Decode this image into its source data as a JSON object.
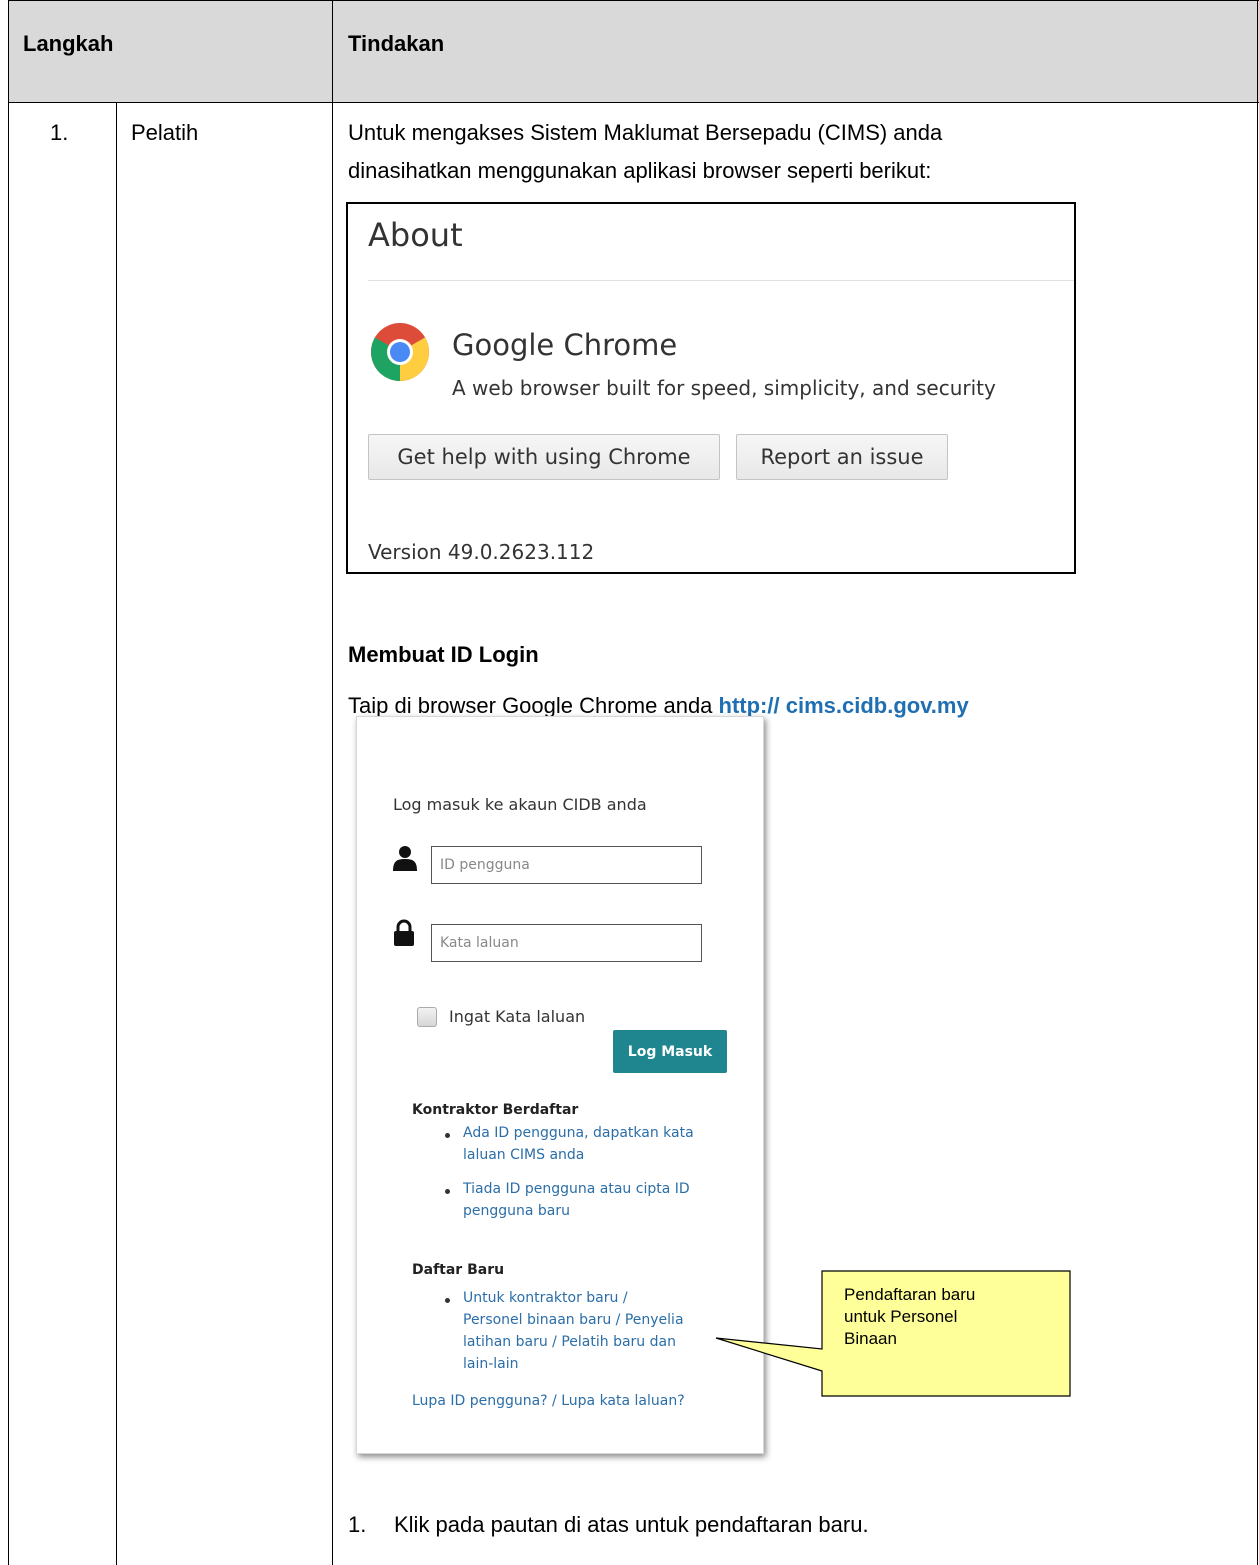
{
  "table": {
    "header": {
      "col1": "Langkah",
      "col2": "Tindakan"
    },
    "row": {
      "number": "1.",
      "role": "Pelatih"
    }
  },
  "content": {
    "intro_line1": "Untuk mengakses Sistem Maklumat Bersepadu (CIMS) anda",
    "intro_line2": "dinasihatkan menggunakan aplikasi browser seperti berikut:",
    "section_heading": "Membuat ID Login",
    "type_prefix": "Taip di browser Google Chrome anda ",
    "url": "http:// cims.cidb.gov.my",
    "step_number": "1.",
    "step_text": "Klik pada pautan di atas untuk pendaftaran baru."
  },
  "about_box": {
    "title": "About",
    "product_name": "Google Chrome",
    "description": "A web browser built for speed, simplicity, and security",
    "help_button": "Get help with using Chrome",
    "report_button": "Report an issue",
    "version": "Version 49.0.2623.112"
  },
  "login_box": {
    "title": "Log masuk ke akaun CIDB anda",
    "user_placeholder": "ID pengguna",
    "password_placeholder": "Kata laluan",
    "remember_label": "Ingat Kata laluan",
    "login_button": "Log Masuk",
    "registered_heading": "Kontraktor Berdaftar",
    "registered_link1_line1": "Ada ID pengguna, dapatkan kata",
    "registered_link1_line2": "laluan CIMS anda",
    "registered_link2_line1": "Tiada ID pengguna atau cipta ID",
    "registered_link2_line2": "pengguna baru",
    "new_heading": "Daftar Baru",
    "new_link_line1": "Untuk kontraktor baru /",
    "new_link_line2": "Personel binaan baru / Penyelia",
    "new_link_line3": "latihan baru / Pelatih baru dan",
    "new_link_line4": "lain-lain",
    "forgot_link": "Lupa ID pengguna? / Lupa kata laluan?"
  },
  "callout": {
    "line1": "Pendaftaran baru",
    "line2": "untuk Personel",
    "line3": "Binaan"
  },
  "colors": {
    "header_bg": "#d9d9d9",
    "url_color": "#1f6fb2",
    "login_button_bg": "#1f8690",
    "link_color": "#2b6ea8",
    "callout_bg": "#ffff99"
  },
  "icons": [
    "chrome-logo-icon",
    "user-icon",
    "lock-icon",
    "checkbox-icon"
  ]
}
